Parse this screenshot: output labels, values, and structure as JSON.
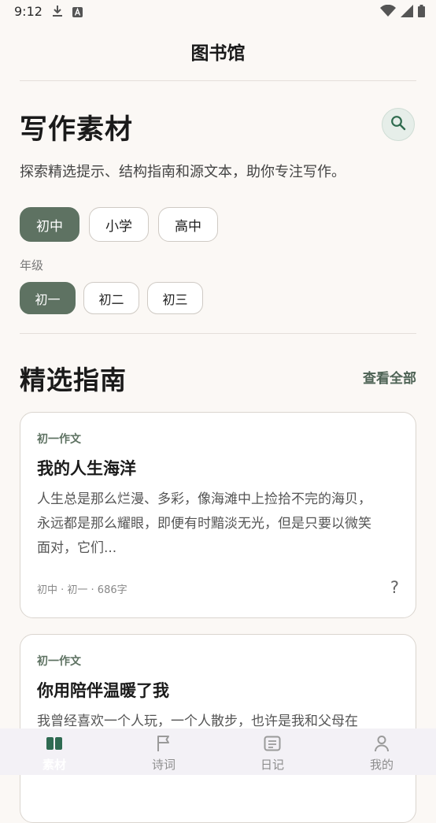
{
  "status_bar": {
    "time": "9:12",
    "left_icons": [
      "download-icon",
      "text-a-icon"
    ],
    "right_icons": [
      "wifi-icon",
      "cellular-signal-icon",
      "battery-icon"
    ]
  },
  "header": {
    "title": "图书馆"
  },
  "page": {
    "title": "写作素材",
    "subtitle": "探索精选提示、结构指南和源文本，助你专注写作。"
  },
  "stage_filters": [
    {
      "label": "初中",
      "active": true
    },
    {
      "label": "小学",
      "active": false
    },
    {
      "label": "高中",
      "active": false
    }
  ],
  "grade_section": {
    "label": "年级",
    "options": [
      {
        "label": "初一",
        "active": true
      },
      {
        "label": "初二",
        "active": false
      },
      {
        "label": "初三",
        "active": false
      }
    ]
  },
  "guides_section": {
    "title": "精选指南",
    "see_all": "查看全部"
  },
  "cards": [
    {
      "tag": "初一作文",
      "title": "我的人生海洋",
      "excerpt": "人生总是那么烂漫、多彩，像海滩中上捡拾不完的海贝，永远都是那么耀眼，即便有时黯淡无光，但是只要以微笑面对，它们...",
      "meta": "初中 · 初一 · 686字",
      "help": "?"
    },
    {
      "tag": "初一作文",
      "title": "你用陪伴温暖了我",
      "excerpt": "我曾经喜欢一个人玩，一个人散步，也许是我和父母在",
      "meta": "",
      "help": ""
    }
  ],
  "bottom_nav": [
    {
      "label": "素材",
      "icon": "book-icon",
      "active": true
    },
    {
      "label": "诗词",
      "icon": "flag-icon",
      "active": false
    },
    {
      "label": "日记",
      "icon": "notebook-icon",
      "active": false
    },
    {
      "label": "我的",
      "icon": "person-icon",
      "active": false
    }
  ],
  "colors": {
    "accent": "#5E7262",
    "background": "#FBF8F5",
    "nav_background": "#F3F1F6",
    "search_button_bg": "#E6EEE9"
  }
}
